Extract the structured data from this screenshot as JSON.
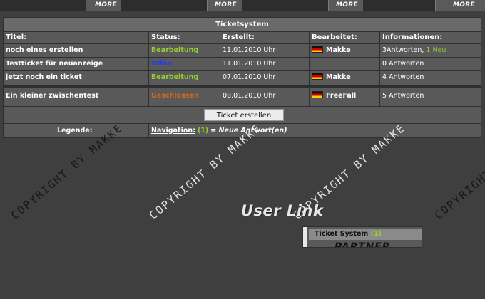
{
  "nav": {
    "more_labels": [
      "MORE",
      "MORE",
      "MORE",
      "MORE"
    ]
  },
  "ticketsystem": {
    "title": "Ticketsystem",
    "columns": [
      "Titel:",
      "Status:",
      "Erstellt:",
      "Bearbeitet:",
      "Informationen:"
    ],
    "rows": [
      {
        "title": "noch eines erstellen",
        "status": "Bearbeitung",
        "created": "11.01.2010 Uhr",
        "edited_by": "Makke",
        "has_flag": true,
        "info": "3Antworten,",
        "info_new": "1 Neu"
      },
      {
        "title": "Testticket für neuanzeige",
        "status": "Offen",
        "created": "11.01.2010 Uhr",
        "edited_by": "",
        "has_flag": false,
        "info": "0 Antworten",
        "info_new": ""
      },
      {
        "title": "jetzt noch ein ticket",
        "status": "Bearbeitung",
        "created": "07.01.2010 Uhr",
        "edited_by": "Makke",
        "has_flag": true,
        "info": "4 Antworten",
        "info_new": ""
      }
    ],
    "closed_rows": [
      {
        "title": "Ein kleiner zwischentest",
        "status": "Geschlossen",
        "created": "08.01.2010 Uhr",
        "edited_by": "FreeFall",
        "has_flag": true,
        "info": "5 Antworten",
        "info_new": ""
      }
    ],
    "create_button": "Ticket erstellen",
    "legend_label": "Legende:",
    "legend_nav": "Navigation:",
    "legend_count": "(1)",
    "legend_desc": "= Neue Antwort(en)"
  },
  "status_colors": {
    "Bearbeitung": "#9acd32",
    "Offen": "#1e3cff",
    "Geschlossen": "#d2691e"
  },
  "accent_new": "#9acd32",
  "watermark": "COPYRIGHT BY MAKKE",
  "user_link": {
    "title": "User Link",
    "item_label": "Ticket System",
    "item_count": "(1)",
    "partner": "PARTNER"
  }
}
